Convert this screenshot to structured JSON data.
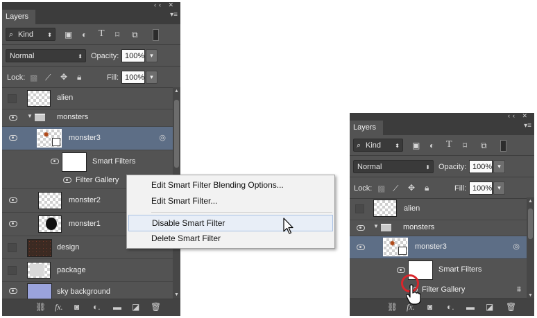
{
  "left_panel": {
    "tab_title": "Layers",
    "panel_controls": "‹‹  ✕",
    "filter_kind": "Kind",
    "blend_mode": "Normal",
    "opacity_label": "Opacity:",
    "opacity_value": "100%",
    "lock_label": "Lock:",
    "fill_label": "Fill:",
    "fill_value": "100%",
    "layers": {
      "alien": "alien",
      "monsters": "monsters",
      "monster3": "monster3",
      "smart_filters": "Smart Filters",
      "filter_gallery": "Filter Gallery",
      "monster2": "monster2",
      "monster1": "monster1",
      "design": "design",
      "package": "package",
      "sky_background": "sky background"
    }
  },
  "context_menu": {
    "items": [
      "Edit Smart Filter Blending Options...",
      "Edit Smart Filter...",
      "Disable Smart Filter",
      "Delete Smart Filter"
    ],
    "highlighted_index": 2
  },
  "right_panel": {
    "tab_title": "Layers",
    "panel_controls": "‹‹  ✕",
    "filter_kind": "Kind",
    "blend_mode": "Normal",
    "opacity_label": "Opacity:",
    "opacity_value": "100%",
    "lock_label": "Lock:",
    "fill_label": "Fill:",
    "fill_value": "100%",
    "layers": {
      "alien": "alien",
      "monsters": "monsters",
      "monster3": "monster3",
      "smart_filters": "Smart Filters",
      "filter_gallery": "Filter Gallery"
    }
  },
  "colors": {
    "panel_bg": "#535353",
    "selected_layer": "#5d6e86",
    "menu_highlight": "#e8eef7",
    "click_marker": "#d9262b"
  }
}
